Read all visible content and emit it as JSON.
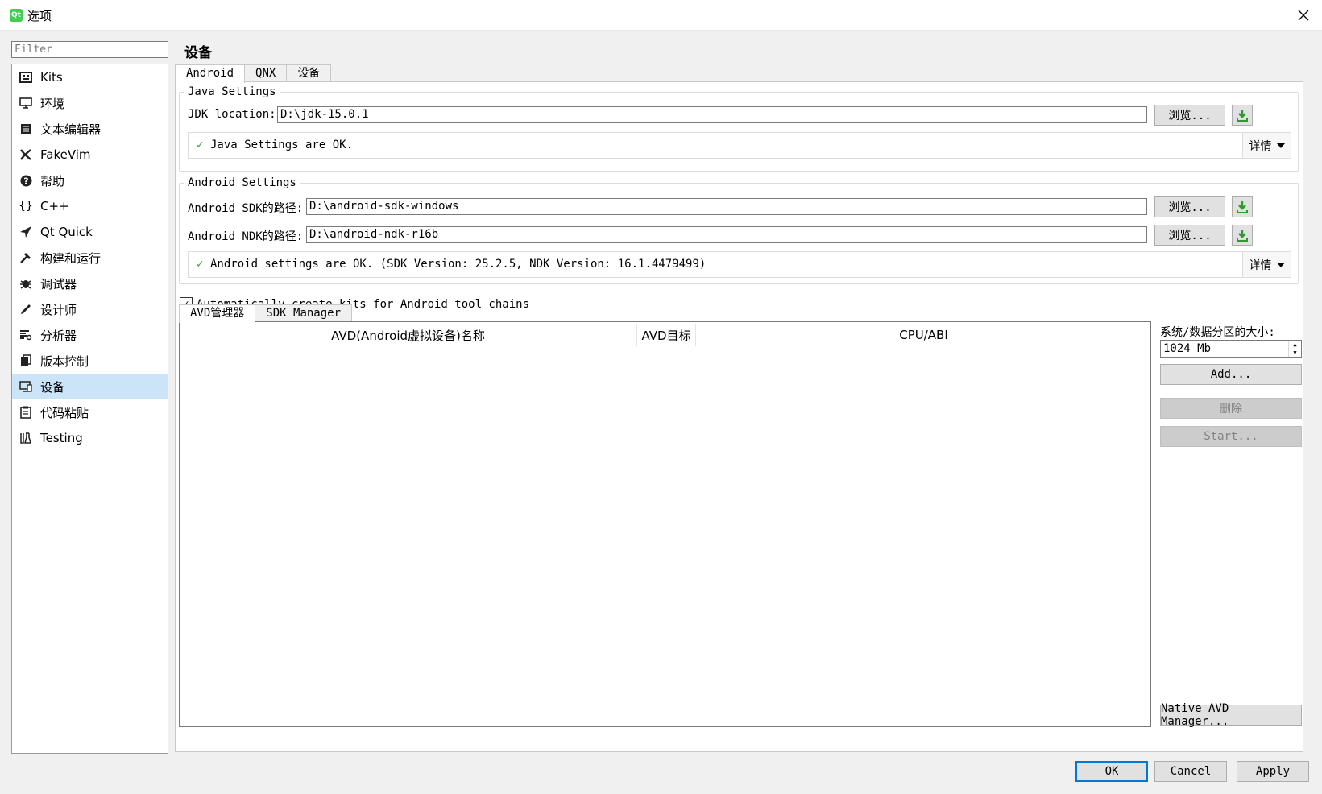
{
  "window": {
    "title": "选项",
    "app_icon_text": "Qt"
  },
  "filter": {
    "placeholder": "Filter"
  },
  "sidebar": {
    "items": [
      {
        "label": "Kits",
        "icon": "kits-icon"
      },
      {
        "label": "环境",
        "icon": "monitor-icon"
      },
      {
        "label": "文本编辑器",
        "icon": "text-editor-icon"
      },
      {
        "label": "FakeVim",
        "icon": "fakevim-icon"
      },
      {
        "label": "帮助",
        "icon": "help-icon"
      },
      {
        "label": "C++",
        "icon": "braces-icon"
      },
      {
        "label": "Qt Quick",
        "icon": "qtquick-icon"
      },
      {
        "label": "构建和运行",
        "icon": "hammer-icon"
      },
      {
        "label": "调试器",
        "icon": "bug-icon"
      },
      {
        "label": "设计师",
        "icon": "pencil-icon"
      },
      {
        "label": "分析器",
        "icon": "analyzer-icon"
      },
      {
        "label": "版本控制",
        "icon": "version-control-icon"
      },
      {
        "label": "设备",
        "icon": "device-icon",
        "selected": true
      },
      {
        "label": "代码粘贴",
        "icon": "clipboard-icon"
      },
      {
        "label": "Testing",
        "icon": "flask-icon"
      }
    ]
  },
  "page": {
    "title": "设备"
  },
  "tabs": [
    {
      "label": "Android",
      "active": true
    },
    {
      "label": "QNX"
    },
    {
      "label": "设备"
    }
  ],
  "java": {
    "group_title": "Java Settings",
    "jdk_label": "JDK location:",
    "jdk_value": "D:\\jdk-15.0.1",
    "browse_label": "浏览...",
    "status_text": "Java Settings are OK.",
    "details_label": "详情"
  },
  "android": {
    "group_title": "Android Settings",
    "sdk_label": "Android SDK的路径:",
    "sdk_value": "D:\\android-sdk-windows",
    "ndk_label": "Android NDK的路径:",
    "ndk_value": "D:\\android-ndk-r16b",
    "browse_label": "浏览...",
    "status_text": "Android settings are OK. (SDK Version: 25.2.5, NDK Version: 16.1.4479499)",
    "details_label": "详情"
  },
  "auto_kits": {
    "label": "Automatically create kits for Android tool chains",
    "checked": true,
    "check_mark": "✓"
  },
  "subtabs": [
    {
      "label": "AVD管理器",
      "active": true
    },
    {
      "label": "SDK Manager"
    }
  ],
  "avd_table": {
    "columns": [
      "AVD(Android虚拟设备)名称",
      "AVD目标",
      "CPU/ABI"
    ],
    "rows": []
  },
  "avd_side": {
    "size_label": "系统/数据分区的大小:",
    "size_value": "1024 Mb",
    "add_label": "Add...",
    "delete_label": "删除",
    "start_label": "Start...",
    "native_label": "Native AVD Manager..."
  },
  "dialog": {
    "ok_label": "OK",
    "cancel_label": "Cancel",
    "apply_label": "Apply"
  },
  "colors": {
    "selection": "#cce4f7",
    "accent": "#0078d7",
    "ok_green": "#3a9c3a",
    "download_green": "#2e9b2e"
  }
}
